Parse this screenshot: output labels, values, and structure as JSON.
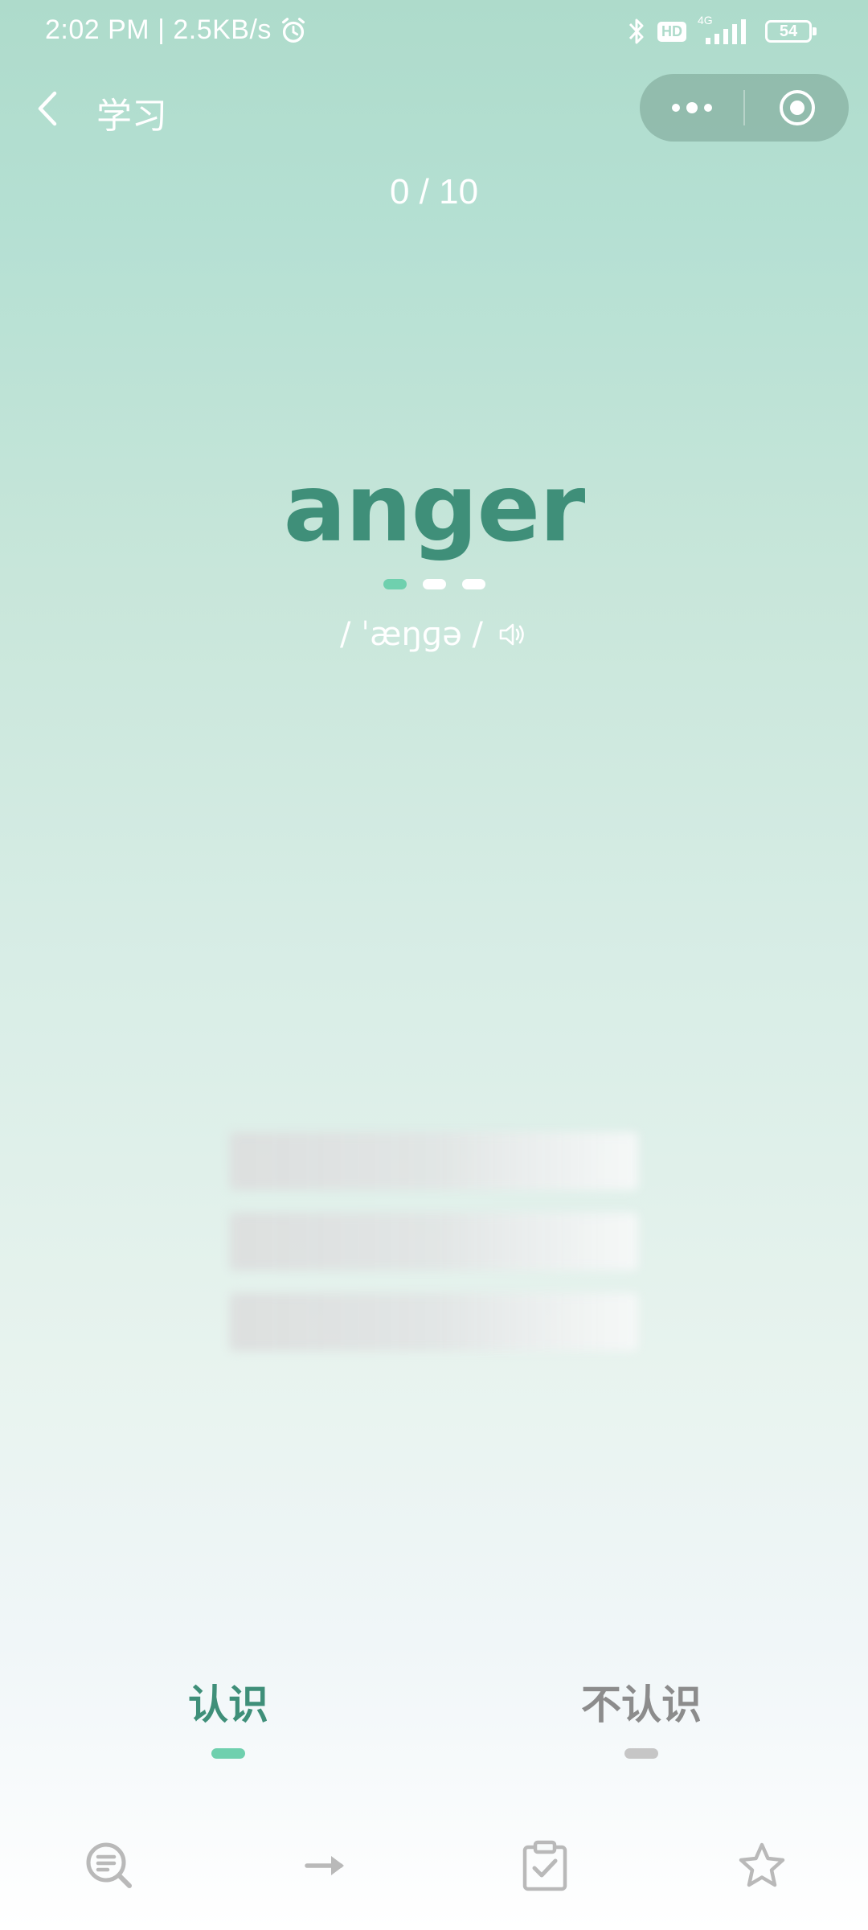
{
  "status_bar": {
    "time_network": "2:02 PM | 2.5KB/s",
    "hd_label": "HD",
    "network_type": "4G",
    "battery": "54",
    "icons": [
      "alarm-icon",
      "bluetooth-icon",
      "hd-icon",
      "signal-icon",
      "battery-icon"
    ]
  },
  "nav": {
    "back_icon": "chevron-left-icon",
    "title": "学习",
    "capsule_icons": [
      "more-dots-icon",
      "close-circle-icon"
    ]
  },
  "progress": {
    "text": "0 / 10",
    "current": 0,
    "total": 10
  },
  "card": {
    "word": "anger",
    "phonetic": "/ ˈæŋɡə /",
    "pager_dots": 3,
    "pager_active_index": 0,
    "speaker_icon": "speaker-icon"
  },
  "answers": {
    "know_label": "认识",
    "unknown_label": "不认识"
  },
  "toolbar": {
    "icons": [
      "search-list-icon",
      "arrow-right-icon",
      "clipboard-check-icon",
      "star-icon"
    ]
  },
  "colors": {
    "accent_green": "#3f8f79",
    "indicator_green": "#6fd0ae",
    "muted_gray": "#8c8c8c",
    "background_top": "#aedbcb"
  }
}
